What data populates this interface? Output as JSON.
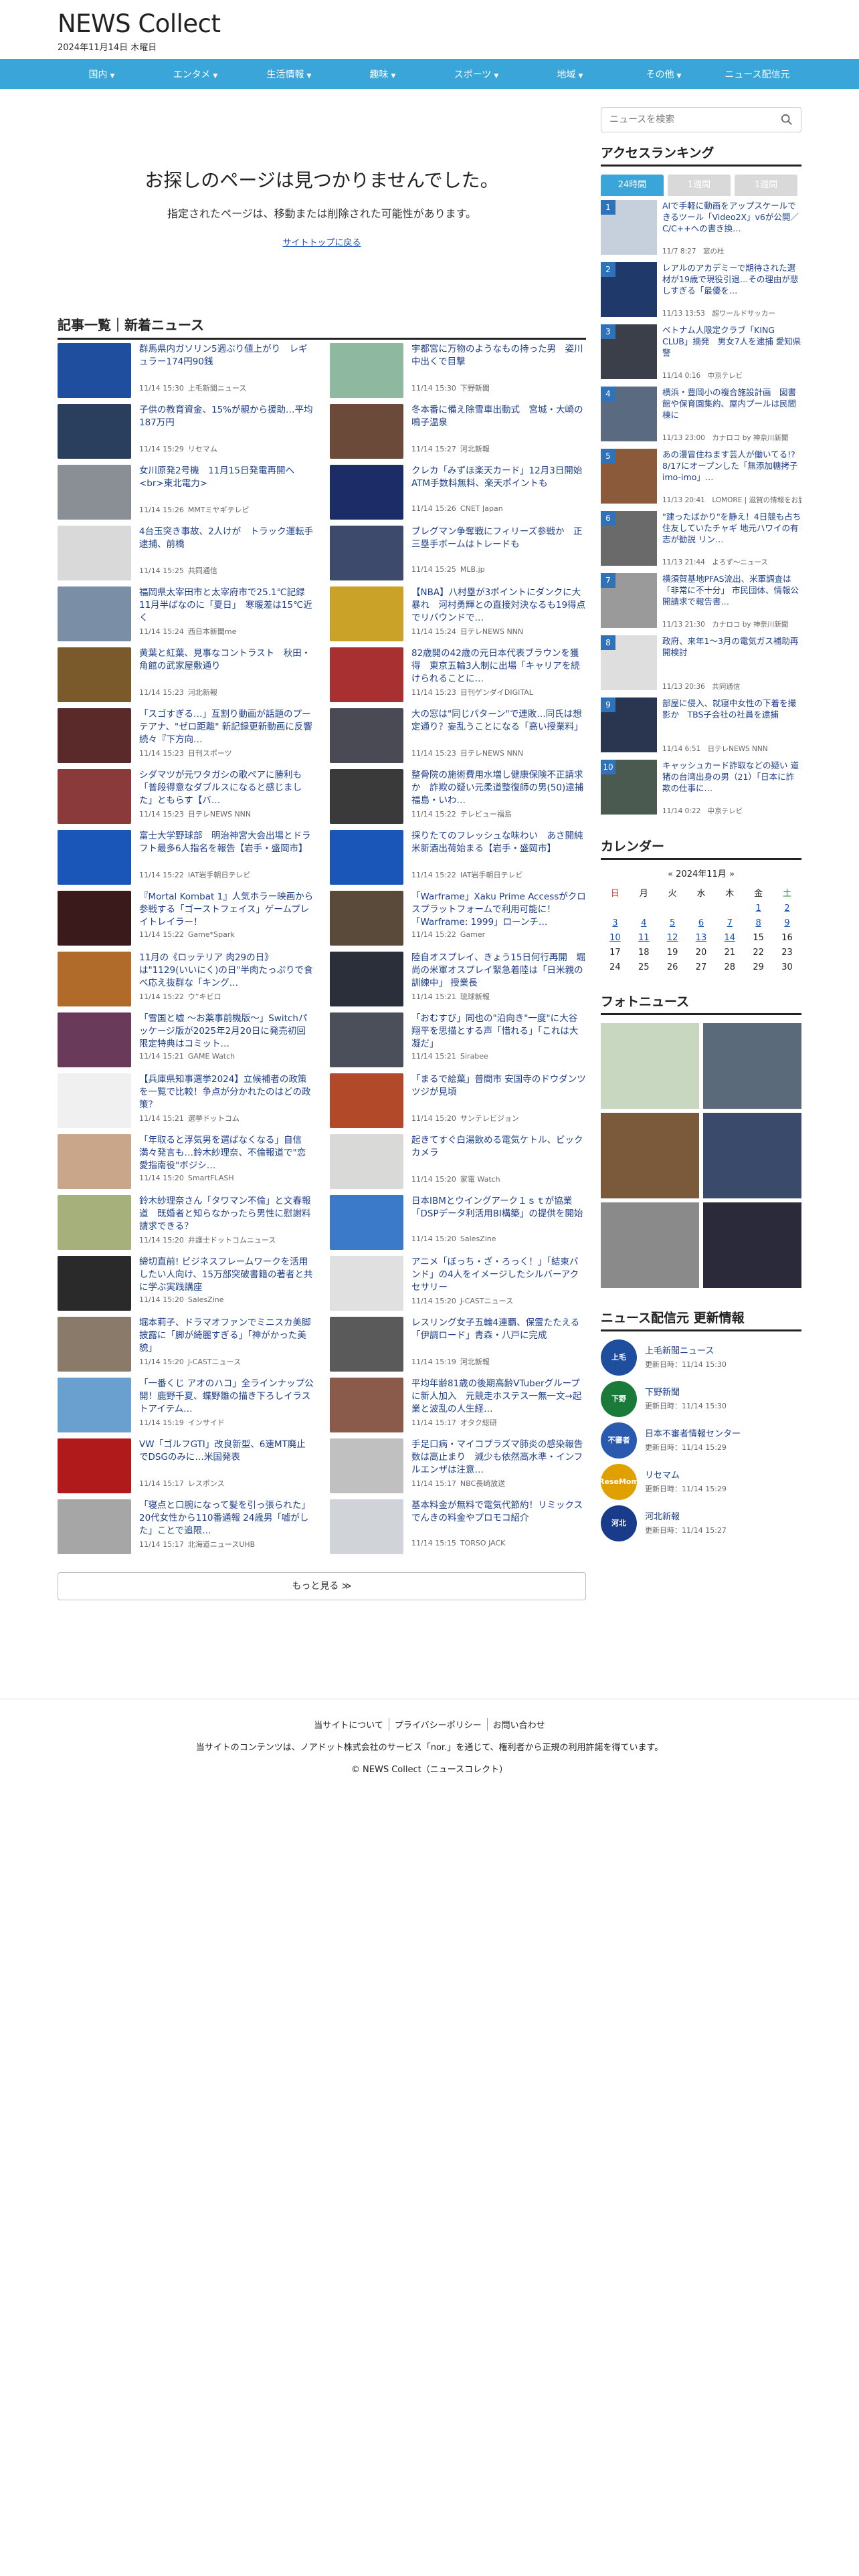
{
  "header": {
    "logo": "NEWS Collect",
    "date": "2024年11月14日 木曜日"
  },
  "nav": [
    {
      "label": "国内",
      "caret": true
    },
    {
      "label": "エンタメ",
      "caret": true
    },
    {
      "label": "生活情報",
      "caret": true
    },
    {
      "label": "趣味",
      "caret": true
    },
    {
      "label": "スポーツ",
      "caret": true
    },
    {
      "label": "地域",
      "caret": true
    },
    {
      "label": "その他",
      "caret": true
    },
    {
      "label": "ニュース配信元",
      "caret": false
    }
  ],
  "not_found": {
    "title": "お探しのページは見つかりませんでした。",
    "message": "指定されたページは、移動または削除された可能性があります。",
    "link": "サイトトップに戻る"
  },
  "articles_title": "記事一覧｜新着ニュース",
  "articles": [
    {
      "title": "群馬県内ガソリン5週ぶり値上がり　レギュラー174円90銭",
      "time": "11/14 15:30",
      "source": "上毛新聞ニュース",
      "color": "#1f4e9e"
    },
    {
      "title": "宇都宮に万物のようなもの持った男　姿川中出くで目撃",
      "time": "11/14 15:30",
      "source": "下野新聞",
      "color": "#8fb8a0"
    },
    {
      "title": "子供の教育資金、15%が親から援助…平均187万円",
      "time": "11/14 15:29",
      "source": "リセマム",
      "color": "#2a3f5e"
    },
    {
      "title": "冬本番に備え除雪車出動式　宮城・大崎の鳴子温泉",
      "time": "11/14 15:27",
      "source": "河北新報",
      "color": "#6b4a3a"
    },
    {
      "title": "女川原発2号機　11月15日発電再開へ<br>東北電力>",
      "time": "11/14 15:26",
      "source": "MMTミヤギテレビ",
      "color": "#8a8f96"
    },
    {
      "title": "クレカ「みずほ楽天カード」12月3日開始　ATM手数料無料、楽天ポイントも",
      "time": "11/14 15:26",
      "source": "CNET Japan",
      "color": "#1b2c66"
    },
    {
      "title": "4台玉突き事故、2人けが　トラック運転手逮捕、前橋",
      "time": "11/14 15:25",
      "source": "共同通信",
      "color": "#d9d9d9"
    },
    {
      "title": "ブレグマン争奪戦にフィリーズ参戦か　正三塁手ボームはトレードも",
      "time": "11/14 15:25",
      "source": "MLB.jp",
      "color": "#3e4a6b"
    },
    {
      "title": "福岡県太宰田市と太宰府市で25.1℃記録　11月半ばなのに「夏日」　寒暖差は15℃近く",
      "time": "11/14 15:24",
      "source": "西日本新聞me",
      "color": "#7a8fa6"
    },
    {
      "title": "【NBA】八村塁が3ポイントにダンクに大暴れ　河村勇輝との直接対決なるも19得点でリバウンドで…",
      "time": "11/14 15:24",
      "source": "日テレNEWS NNN",
      "color": "#c9a227"
    },
    {
      "title": "黄葉と紅葉、見事なコントラスト　秋田・角館の武家屋敷通り",
      "time": "11/14 15:23",
      "source": "河北新報",
      "color": "#7a5a2a"
    },
    {
      "title": "82歳開の42歳の元日本代表ブラウンを獲得　東京五輪3人制に出場「キャリアを続けられることに…",
      "time": "11/14 15:23",
      "source": "日刊ゲンダイDIGITAL",
      "color": "#a83030"
    },
    {
      "title": "「スゴすぎる…」互割り動画が話題のプーテアナ、\"ゼロ距離\" 新記録更新動画に反響続々『下方向…",
      "time": "11/14 15:23",
      "source": "日刊スポーツ",
      "color": "#5a2a2a"
    },
    {
      "title": "大の窓は\"同じパターン\"で連敗…同氏は想定通り？妄乱うことになる「高い授業料」",
      "time": "11/14 15:23",
      "source": "日テレNEWS NNN",
      "color": "#4a4a55"
    },
    {
      "title": "シダマツが元ワタガシの歌ペアに勝利も「普段得意なダブルスになると感じました」ともらす【バ…",
      "time": "11/14 15:23",
      "source": "日テレNEWS NNN",
      "color": "#8a3a3a"
    },
    {
      "title": "整骨院の施術費用水増し健康保険不正請求か　詐欺の疑い元柔道整復師の男(50)逮捕　福島・いわ…",
      "time": "11/14 15:22",
      "source": "テレビュー福島",
      "color": "#3a3a3a"
    },
    {
      "title": "富士大学野球部　明治神宮大会出場とドラフト最多6人指名を報告【岩手・盛岡市】",
      "time": "11/14 15:22",
      "source": "IAT岩手朝日テレビ",
      "color": "#1a56b8"
    },
    {
      "title": "採りたてのフレッシュな味わい　あさ開純米新酒出荷始まる【岩手・盛岡市】",
      "time": "11/14 15:22",
      "source": "IAT岩手朝日テレビ",
      "color": "#1a56b8"
    },
    {
      "title": "『Mortal Kombat 1』人気ホラー映画から参戦する「ゴーストフェイス」ゲームプレイトレイラー！",
      "time": "11/14 15:22",
      "source": "Game*Spark",
      "color": "#3a1a1a"
    },
    {
      "title": "「Warframe」Xaku Prime Accessがクロスプラットフォームで利用可能に！「Warframe: 1999」ローンチ…",
      "time": "11/14 15:22",
      "source": "Gamer",
      "color": "#5a4a3a"
    },
    {
      "title": "11月の《ロッテリア 肉29の日》は\"1129(いいにく)の日\"半肉たっぷりで食べ応え抜群な「キング…",
      "time": "11/14 15:22",
      "source": "ウ”キビロ",
      "color": "#b06a2a"
    },
    {
      "title": "陸自オスプレイ、きょう15日何行再開　堀尚の米軍オスプレイ緊急着陸は「日米親の訓練中」 授業長",
      "time": "11/14 15:21",
      "source": "琉球新報",
      "color": "#2a2f3a"
    },
    {
      "title": "「雪国と嘘 ～お薬事前機版～」Switchパッケージ版が2025年2月20日に発売初回限定特典はコミット…",
      "time": "11/14 15:21",
      "source": "GAME Watch",
      "color": "#6a3a5a"
    },
    {
      "title": "「おむすび」同也の\"沿向き\"一度\"に大谷翔平を思描とする声「惜れる」「これは大凝だ」",
      "time": "11/14 15:21",
      "source": "Sirabee",
      "color": "#4a4f5a"
    },
    {
      "title": "【兵庫県知事選挙2024】立候補者の政策を一覧で比較！争点が分かれたのはどの政策？",
      "time": "11/14 15:21",
      "source": "選挙ドットコム",
      "color": "#f0f0f0"
    },
    {
      "title": "「まるで絵葉」普間市 安国寺のドウダンツツジが見頃",
      "time": "11/14 15:20",
      "source": "サンテレビジョン",
      "color": "#b24a2a"
    },
    {
      "title": "「年取ると浮気男を選ばなくなる」自信満々発言も…鈴木紗理奈、不倫報道で\"恋愛指南役\"ボジシ…",
      "time": "11/14 15:20",
      "source": "SmartFLASH",
      "color": "#c9a68a"
    },
    {
      "title": "起きてすぐ白湯飲める電気ケトル、ビックカメラ",
      "time": "11/14 15:20",
      "source": "家電 Watch",
      "color": "#d9dad8"
    },
    {
      "title": "鈴木紗理奈さん「タワマン不倫」と文春報道　既婚者と知らなかったら男性に慰謝料請求できる？",
      "time": "11/14 15:20",
      "source": "弁護士ドットコムニュース",
      "color": "#a6b07a"
    },
    {
      "title": "日本IBMとウイングアーク１ｓｔが協業「DSPデータ利活用BI構築」の提供を開始",
      "time": "11/14 15:20",
      "source": "SalesZine",
      "color": "#3a7ac9"
    },
    {
      "title": "締切直前! ビジネスフレームワークを活用したい人向け、15万部突破書籍の著者と共に学ぶ実践講座",
      "time": "11/14 15:20",
      "source": "SalesZine",
      "color": "#2a2a2a"
    },
    {
      "title": "アニメ「ぼっち・ざ・ろっく！」「結束バンド」の4人をイメージしたシルバーアクセサリー",
      "time": "11/14 15:20",
      "source": "J-CASTニュース",
      "color": "#e0e0e0"
    },
    {
      "title": "堀本莉子、ドラマオファンでミニスカ美脚披露に「脚が綺麗すぎる」「神がかった美貌」",
      "time": "11/14 15:20",
      "source": "J-CASTニュース",
      "color": "#8a7a6a"
    },
    {
      "title": "レスリング女子五輪4連覇、保霊たたえる「伊調ロード」青森・八戸に完成",
      "time": "11/14 15:19",
      "source": "河北新報",
      "color": "#5a5a5a"
    },
    {
      "title": "「一番くじ アオのハコ」全ラインナップ公開！鹿野千夏、蝶野雛の描き下ろしイラストアイテム…",
      "time": "11/14 15:19",
      "source": "インサイド",
      "color": "#6aa0d0"
    },
    {
      "title": "平均年齢81歳の後期高齢VTuberグループに新人加入　元競走ホステス一無一文→起業と波乱の人生経…",
      "time": "11/14 15:17",
      "source": "オタク総研",
      "color": "#8a5a4a"
    },
    {
      "title": "VW「ゴルフGTI」改良新型、6速MT廃止でDSGのみに…米国発表",
      "time": "11/14 15:17",
      "source": "レスポンス",
      "color": "#b01a1a"
    },
    {
      "title": "手足口病・マイコプラズマ肺炎の感染報告数は高止まり　減少も依然高水準・インフルエンザは注意…",
      "time": "11/14 15:17",
      "source": "NBC長崎放送",
      "color": "#c0c0c0"
    },
    {
      "title": "「寝点と口腕になって髪を引っ張られた」20代女性から110番通報 24歳男「嘘がした」ことで追限…",
      "time": "11/14 15:17",
      "source": "北海道ニュースUHB",
      "color": "#a6a6a6"
    },
    {
      "title": "基本料金が無料で電気代節約！リミックスでんきの料金やプロモコ紹介",
      "time": "11/14 15:15",
      "source": "TORSO JACK",
      "color": "#d0d4d8"
    }
  ],
  "more_button": "もっと見る ≫",
  "sidebar": {
    "search_placeholder": "ニュースを検索",
    "ranking_title": "アクセスランキング",
    "ranking_tabs": [
      {
        "label": "24時間",
        "active": true
      },
      {
        "label": "1週間",
        "active": false
      },
      {
        "label": "1週間",
        "active": false
      }
    ],
    "ranking": [
      {
        "num": "1",
        "title": "AIで手軽に動画をアップスケールできるツール「Video2X」v6が公開／C/C++への書き換…",
        "meta": "11/7 8:27　窓の杜",
        "color": "#c5d0dc"
      },
      {
        "num": "2",
        "title": "レアルのアカデミーで期待された選材が19歳で現役引退…その理由が悲しすぎる「最優を…",
        "meta": "11/13 13:53　超ワールドサッカー",
        "color": "#1f3a6a"
      },
      {
        "num": "3",
        "title": "ベトナム人限定クラブ「KING CLUB」摘発　男女7人を逮捕 愛知県警",
        "meta": "11/14 0:16　中京テレビ",
        "color": "#3a3f4a"
      },
      {
        "num": "4",
        "title": "横浜・豊岡小の複合施設計画　図書館や保育園集約、屋内プールは民間棟に",
        "meta": "11/13 23:00　カナロコ by 神奈川新聞",
        "color": "#5a6a80"
      },
      {
        "num": "5",
        "title": "あの漫冒住ねます芸人が働いてる!? 8/17にオープンした「無添加糖拷子 imo-imo」…",
        "meta": "11/13 20:41　LOMORE | 滋賀の情報をお届け！",
        "color": "#8a5a3a"
      },
      {
        "num": "6",
        "title": "\"建ったばかり\"を静え！4日競も占ち住友していたチャギ 地元ハワイの有志が勧説 リン…",
        "meta": "11/13 21:44　よろず～ニュース",
        "color": "#6a6a6a"
      },
      {
        "num": "7",
        "title": "横須賀基地PFAS流出、米軍調査は「非常に不十分」 市民団体、情報公開請求で報告書…",
        "meta": "11/13 21:30　カナロコ by 神奈川新聞",
        "color": "#9a9a9a"
      },
      {
        "num": "8",
        "title": "政府、来年1～3月の電気ガス補助再開検討",
        "meta": "11/13 20:36　共同通信",
        "color": "#dedede"
      },
      {
        "num": "9",
        "title": "部屋に侵入、就寝中女性の下着を撮影か　TBS子会社の社員を逮捕",
        "meta": "11/14 6:51　日テレNEWS NNN",
        "color": "#2a3550"
      },
      {
        "num": "10",
        "title": "キャッシュカード詐取などの疑い 道猪の台湾出身の男（21）「日本に詐欺の仕事に…",
        "meta": "11/14 0:22　中京テレビ",
        "color": "#4a5a50"
      }
    ],
    "calendar_title": "カレンダー",
    "calendar_month": "2024年11月",
    "weekdays": [
      "日",
      "月",
      "火",
      "水",
      "木",
      "金",
      "土"
    ],
    "photo_title": "フォトニュース",
    "photos": [
      "#c8d8c0",
      "#5a6a7a",
      "#7a5a3a",
      "#3a4a6a",
      "#8a8a8a",
      "#2a2a3a"
    ],
    "sources_title": "ニュース配信元 更新情報",
    "sources": [
      {
        "name": "上毛新聞ニュース",
        "updated": "更新日時：11/14 15:30",
        "logo_text": "上毛",
        "color": "#1f4e9e"
      },
      {
        "name": "下野新聞",
        "updated": "更新日時：11/14 15:30",
        "logo_text": "下野",
        "color": "#1a7a3a"
      },
      {
        "name": "日本不審者情報センター",
        "updated": "更新日時：11/14 15:29",
        "logo_text": "不審者",
        "color": "#2a5ab0"
      },
      {
        "name": "リセマム",
        "updated": "更新日時：11/14 15:29",
        "logo_text": "ReseMom",
        "color": "#e0a000"
      },
      {
        "name": "河北新報",
        "updated": "更新日時：11/14 15:27",
        "logo_text": "河北",
        "color": "#1a3a8a"
      }
    ]
  },
  "footer": {
    "links": [
      "当サイトについて",
      "プライバシーポリシー",
      "お問い合わせ"
    ],
    "notice": "当サイトのコンテンツは、ノアドット株式会社のサービス「nor.」を通じて、権利者から正規の利用許諾を得ています。",
    "copyright": "© NEWS Collect（ニュースコレクト）"
  }
}
